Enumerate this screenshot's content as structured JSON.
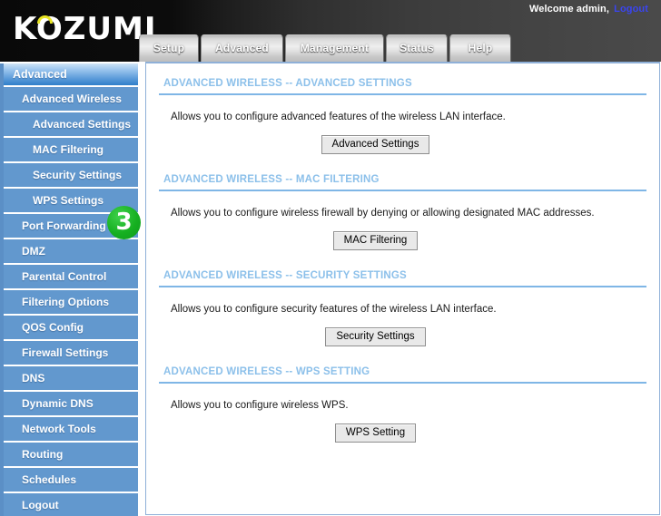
{
  "header": {
    "logo_text": "KOZUMI",
    "logo_accent_icon": "yellow-arc-accent",
    "welcome_text": "Welcome admin,",
    "logout_link": "Logout"
  },
  "tabs": [
    {
      "label": "Setup"
    },
    {
      "label": "Advanced"
    },
    {
      "label": "Management"
    },
    {
      "label": "Status"
    },
    {
      "label": "Help"
    }
  ],
  "sidebar": {
    "header": "Advanced",
    "items": [
      {
        "label": "Advanced Wireless"
      },
      {
        "label": "Advanced Settings"
      },
      {
        "label": "MAC Filtering"
      },
      {
        "label": "Security Settings"
      },
      {
        "label": "WPS Settings"
      },
      {
        "label": "Port Forwarding"
      },
      {
        "label": "DMZ"
      },
      {
        "label": "Parental Control"
      },
      {
        "label": "Filtering Options"
      },
      {
        "label": "QOS Config"
      },
      {
        "label": "Firewall Settings"
      },
      {
        "label": "DNS"
      },
      {
        "label": "Dynamic DNS"
      },
      {
        "label": "Network Tools"
      },
      {
        "label": "Routing"
      },
      {
        "label": "Schedules"
      },
      {
        "label": "Logout"
      }
    ]
  },
  "step_badge": {
    "number": "3",
    "color": "#16b021"
  },
  "main": {
    "sections": [
      {
        "title": "ADVANCED WIRELESS -- ADVANCED SETTINGS",
        "description": "Allows you to configure advanced features of the wireless LAN interface.",
        "button": "Advanced Settings"
      },
      {
        "title": "ADVANCED WIRELESS -- MAC FILTERING",
        "description": "Allows you to configure wireless firewall by denying or allowing designated MAC addresses.",
        "button": "MAC Filtering"
      },
      {
        "title": "ADVANCED WIRELESS -- SECURITY SETTINGS",
        "description": "Allows you to configure security features of the wireless LAN interface.",
        "button": "Security Settings"
      },
      {
        "title": "ADVANCED WIRELESS -- WPS SETTING",
        "description": "Allows you to configure wireless WPS.",
        "button": "WPS Setting"
      }
    ]
  },
  "colors": {
    "sidebar_blue": "#6298ce",
    "accent_blue": "#7fb6e6",
    "title_blue": "#8cc0ea",
    "badge_green": "#16b021",
    "link_blue": "#3a45f0",
    "logo_yellow": "#e8e422"
  }
}
